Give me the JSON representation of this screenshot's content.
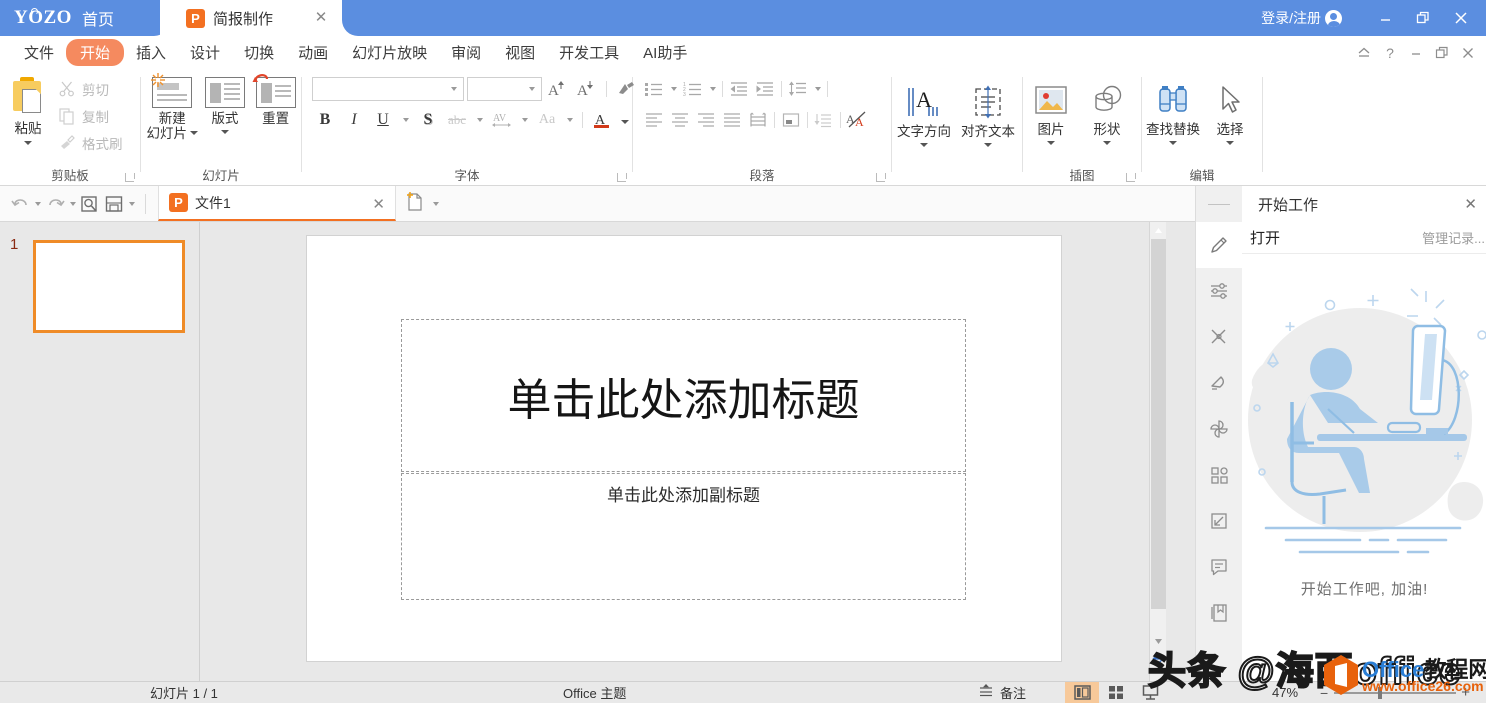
{
  "titlebar": {
    "brand": "YOZO",
    "home_label": "首页",
    "doc_tab_label": "简报制作",
    "doc_tab_icon": "powerpoint-icon",
    "tab_close_icon": "close-icon",
    "login_label": "登录/注册",
    "avatar_icon": "user-avatar-icon",
    "minimize_icon": "minimize-icon",
    "restore_icon": "restore-icon",
    "close_icon": "close-icon",
    "bg_color": "#5b8ee0"
  },
  "menubar": {
    "items": [
      {
        "label": "文件",
        "active": false
      },
      {
        "label": "开始",
        "active": true
      },
      {
        "label": "插入",
        "active": false
      },
      {
        "label": "设计",
        "active": false
      },
      {
        "label": "切换",
        "active": false
      },
      {
        "label": "动画",
        "active": false
      },
      {
        "label": "幻灯片放映",
        "active": false
      },
      {
        "label": "审阅",
        "active": false
      },
      {
        "label": "视图",
        "active": false
      },
      {
        "label": "开发工具",
        "active": false
      },
      {
        "label": "AI助手",
        "active": false
      }
    ],
    "active_color": "#f58a5f",
    "right_icons": [
      "collapse-ribbon-icon",
      "help-icon",
      "minimize-icon",
      "restore-icon",
      "close-icon"
    ]
  },
  "ribbon": {
    "clipboard": {
      "group_title": "剪贴板",
      "paste_label": "粘贴",
      "cut_label": "剪切",
      "copy_label": "复制",
      "format_painter_label": "格式刷"
    },
    "slide": {
      "group_title": "幻灯片",
      "new_slide_label": "新建\n幻灯片",
      "new_slide_line1": "新建",
      "new_slide_line2": "幻灯片",
      "layout_label": "版式",
      "reset_label": "重置"
    },
    "font": {
      "group_title": "字体",
      "font_name_value": "",
      "font_size_value": "",
      "grow_font_icon": "grow-font-icon",
      "shrink_font_icon": "shrink-font-icon",
      "clear_format_icon": "clear-formatting-icon",
      "bold_icon": "B",
      "italic_icon": "I",
      "underline_icon": "U",
      "shadow_icon": "S",
      "strikethrough_icon": "abc",
      "char_spacing_icon": "AV",
      "change_case_icon": "Aa",
      "font_color_icon": "A"
    },
    "paragraph": {
      "group_title": "段落",
      "bullets_icon": "bullet-list-icon",
      "numbering_icon": "numbered-list-icon",
      "decrease_indent_icon": "decrease-indent-icon",
      "increase_indent_icon": "increase-indent-icon",
      "line_spacing_icon": "line-spacing-icon",
      "align_left_icon": "align-left-icon",
      "align_center_icon": "align-center-icon",
      "align_right_icon": "align-right-icon",
      "justify_icon": "justify-icon",
      "distribute_icon": "distribute-icon",
      "columns_icon": "columns-icon",
      "text_indent_icon": "text-indent-icon",
      "clear_para_icon": "clear-paragraph-icon"
    },
    "textdir": {
      "text_direction_label": "文字方向",
      "align_text_label": "对齐文本",
      "text_direction_icon": "text-direction-icon",
      "align_text_icon": "align-text-icon"
    },
    "illustration": {
      "group_title": "插图",
      "picture_label": "图片",
      "shape_label": "形状",
      "picture_icon": "picture-icon",
      "shape_icon": "shape-icon"
    },
    "editing": {
      "group_title": "编辑",
      "find_replace_label": "查找替换",
      "select_label": "选择",
      "find_replace_icon": "binoculars-icon",
      "select_icon": "cursor-arrow-icon"
    }
  },
  "qat": {
    "undo_icon": "undo-icon",
    "redo_icon": "redo-icon",
    "preview_icon": "print-preview-icon",
    "save_icon": "save-icon",
    "more_icon": "chevron-down-icon",
    "file_tab_label": "文件1",
    "file_tab_icon": "powerpoint-icon",
    "file_tab_close_icon": "close-icon",
    "new_doc_icon": "new-document-icon",
    "accent_color": "#f37021"
  },
  "thumbnails": {
    "slides": [
      {
        "number": "1",
        "selected": true
      }
    ],
    "selected_border_color": "#ef8b27"
  },
  "slide": {
    "title_placeholder": "单击此处添加标题",
    "subtitle_placeholder": "单击此处添加副标题"
  },
  "scrollbar": {
    "up_icon": "triangle-up-icon",
    "down_icon": "triangle-down-icon",
    "fit_icon": "fit-slide-icon"
  },
  "right_panel": {
    "title": "开始工作",
    "close_icon": "close-icon",
    "grip_icon": "panel-grip-icon",
    "open_label": "打开",
    "manage_label": "管理记录...",
    "illustration_caption": "开始工作吧, 加油!",
    "strip_icons": [
      {
        "name": "pen-icon",
        "selected": true
      },
      {
        "name": "settings-sliders-icon",
        "selected": false
      },
      {
        "name": "tools-icon",
        "selected": false
      },
      {
        "name": "bell-icon",
        "selected": false
      },
      {
        "name": "pinwheel-icon",
        "selected": false
      },
      {
        "name": "apps-grid-icon",
        "selected": false
      },
      {
        "name": "expand-icon",
        "selected": false
      },
      {
        "name": "comment-icon",
        "selected": false
      },
      {
        "name": "book-icon",
        "selected": false
      }
    ]
  },
  "statusbar": {
    "slide_counter": "幻灯片 1 / 1",
    "theme": "Office 主题",
    "notes_label": "备注",
    "notes_icon": "notes-icon",
    "view_normal_icon": "normal-view-icon",
    "view_sorter_icon": "slide-sorter-icon",
    "view_reading_icon": "reading-view-icon",
    "zoom_level": "47%",
    "zoom_minus": "−",
    "zoom_plus": "+"
  },
  "watermarks": {
    "toutiao": "头条 @海西office",
    "office_brand_en": "Office",
    "office_brand_cn": "教程网",
    "office_url": "www.office26.com"
  }
}
